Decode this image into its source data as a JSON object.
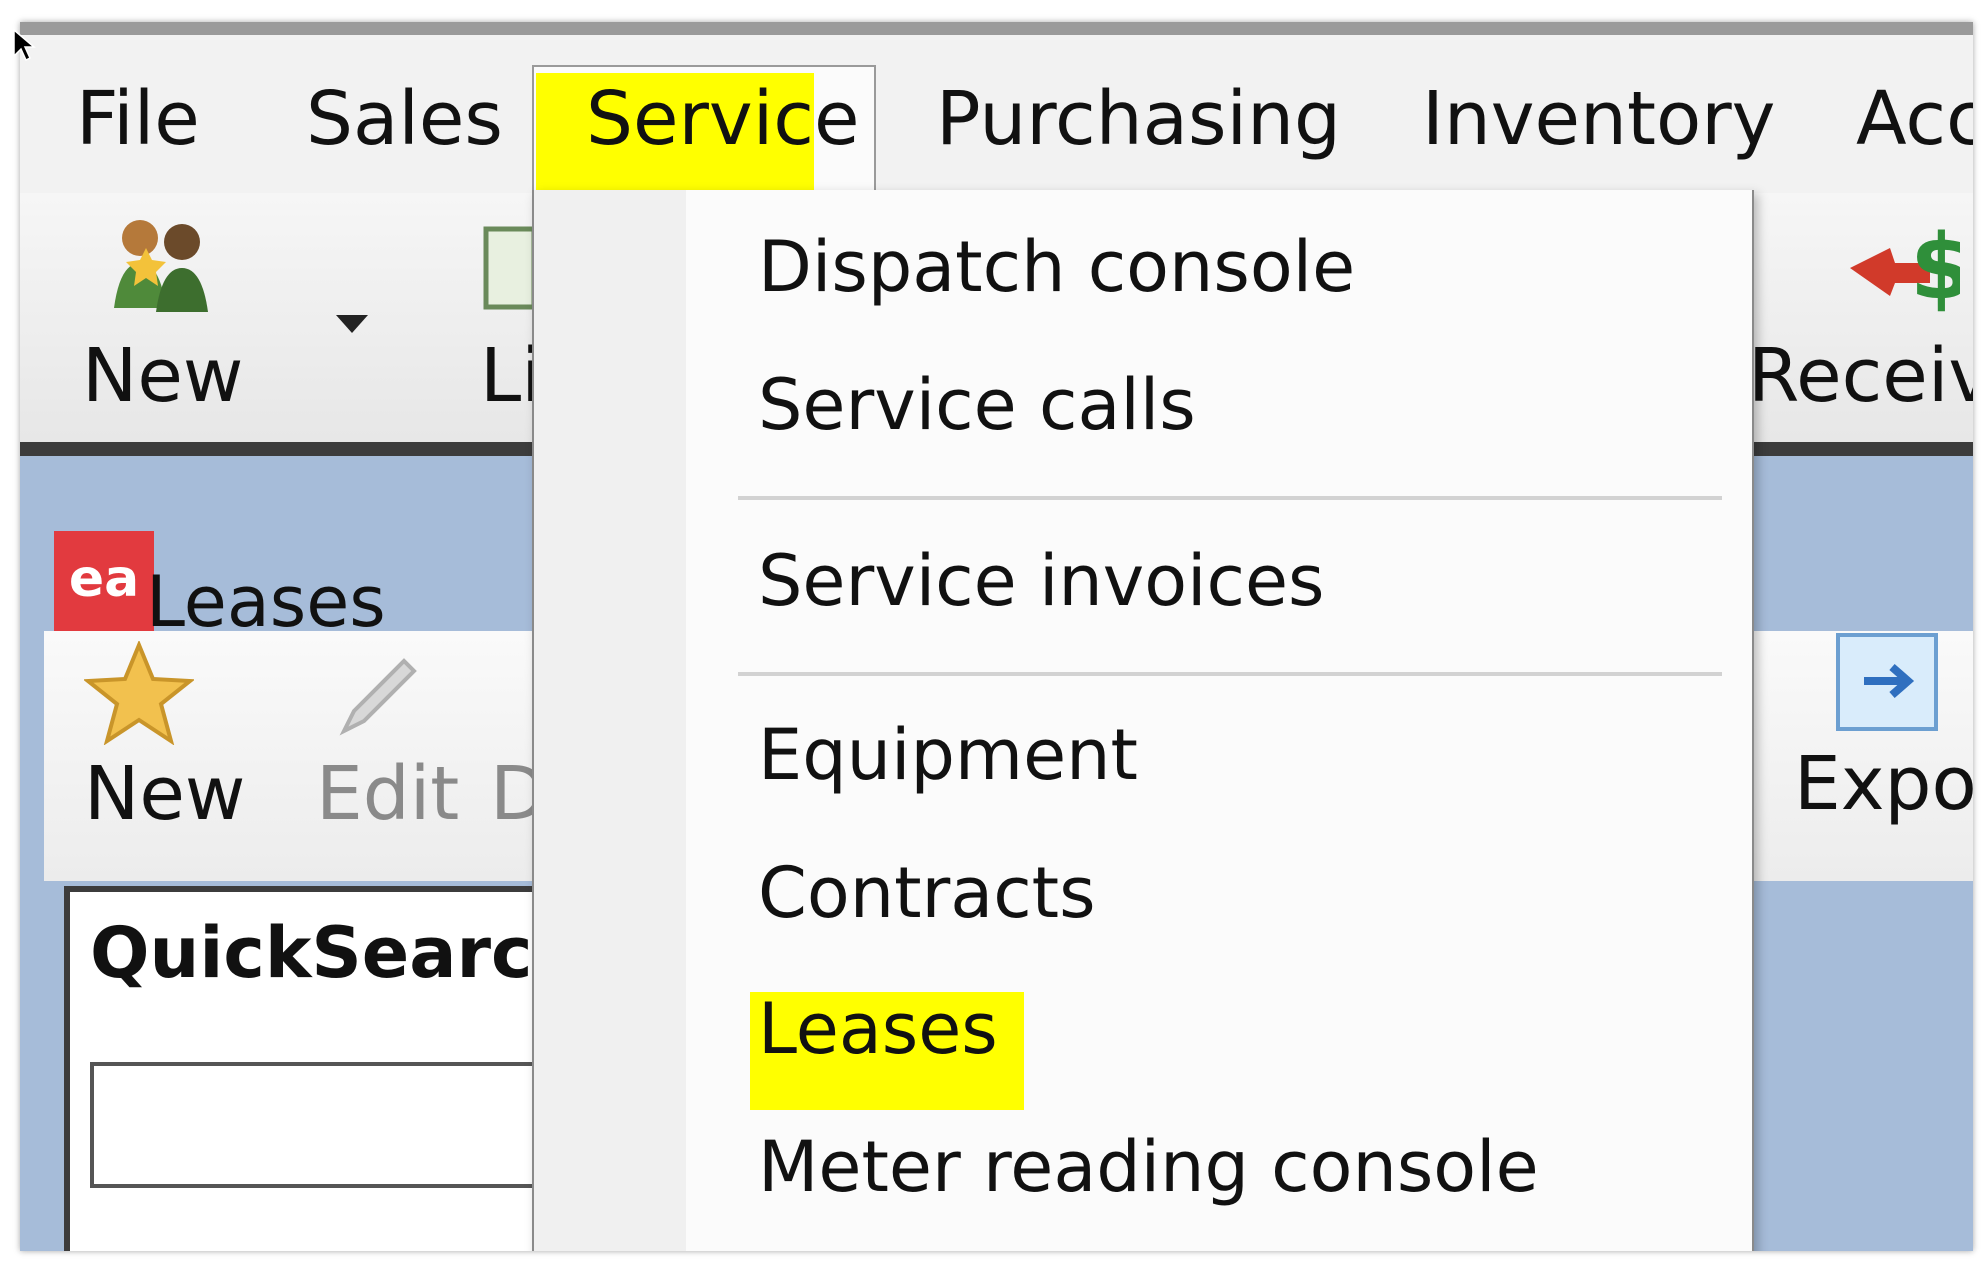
{
  "menubar": {
    "items": [
      "File",
      "Sales",
      "Service",
      "Purchasing",
      "Inventory",
      "Acc"
    ]
  },
  "toolbar": {
    "new_label": "New",
    "list_label": "Li",
    "receivables_label": "Receival"
  },
  "window": {
    "logo_text": "ea",
    "title": "Leases"
  },
  "inner_toolbar": {
    "new_label": "New",
    "edit_label": "Edit",
    "d_label": "D",
    "export_label": "Export"
  },
  "quicksearch": {
    "label": "QuickSearch",
    "value": ""
  },
  "service_menu": {
    "items": [
      "Dispatch console",
      "Service calls",
      "Service invoices",
      "Equipment",
      "Contracts",
      "Leases",
      "Meter reading console"
    ]
  },
  "colors": {
    "highlight": "#ffff00",
    "inner_background": "#a6bcd9",
    "logo_red": "#e23a3f"
  }
}
